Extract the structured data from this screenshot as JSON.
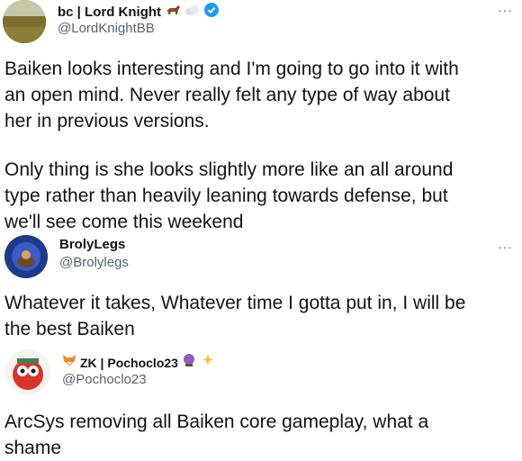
{
  "tweets": [
    {
      "name": "bc | Lord Knight",
      "handle": "@LordKnightBB",
      "emojis": [
        "horse-icon",
        "cloud-icon"
      ],
      "verified": true,
      "more": "···",
      "lines": [
        "Baiken looks interesting and I'm going to go into it with",
        "an open mind. Never really felt any type of way about",
        "her in previous versions.",
        "",
        "Only thing is she looks slightly more like an all around",
        "type rather than heavily leaning towards defense, but",
        "we'll see come this weekend"
      ]
    },
    {
      "name": "BrolyLegs",
      "handle": "@Brolylegs",
      "more": "···",
      "lines": [
        "Whatever it takes, Whatever time I gotta put in, I will be",
        "the best Baiken"
      ]
    },
    {
      "name": "ZK | Pochoclo23",
      "handle": "@Pochoclo23",
      "emojis": [
        "fox-icon",
        "crystal-ball-icon",
        "sparkles-icon"
      ],
      "lines": [
        "ArcSys removing all Baiken core gameplay, what a",
        "shame"
      ]
    }
  ],
  "colors": {
    "text": "#0f1419",
    "secondary": "#536471",
    "verified": "#1d9bf0"
  }
}
